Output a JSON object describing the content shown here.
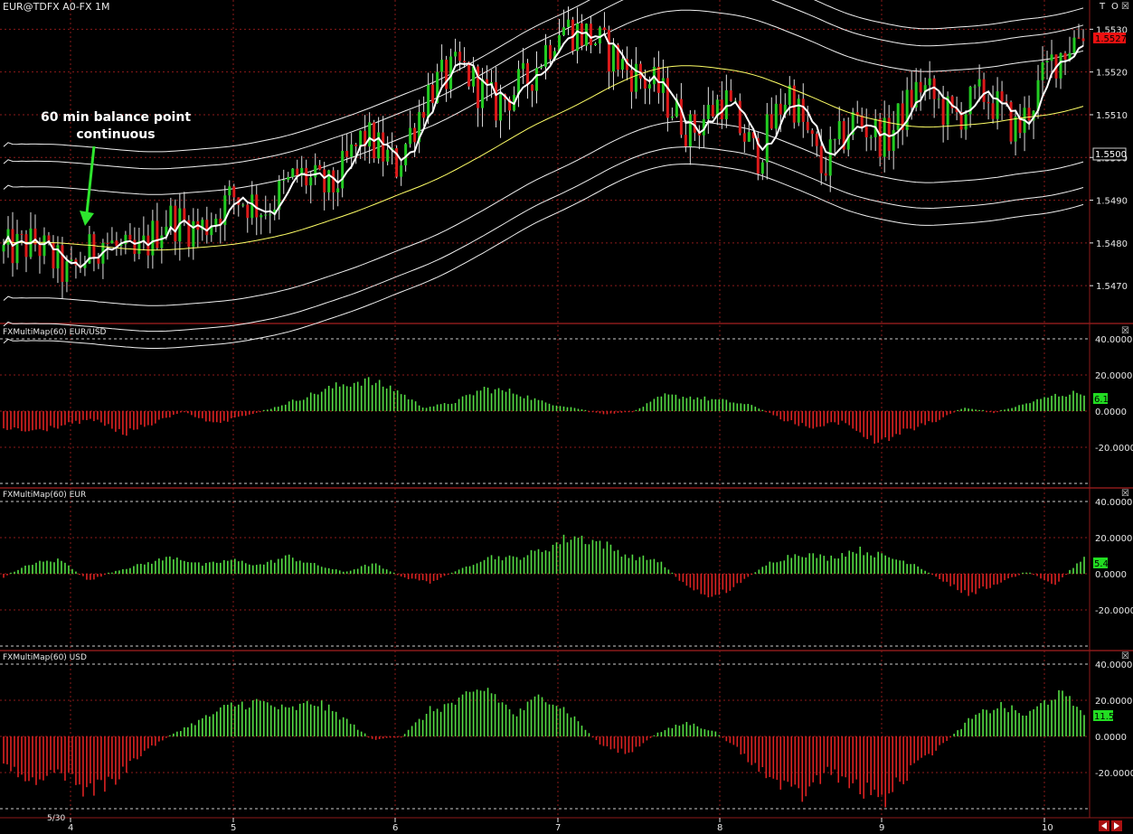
{
  "window": {
    "title": "EUR@TDFX A0-FX 1M",
    "corner_buttons": [
      "T",
      "O",
      "☒"
    ]
  },
  "annotation": {
    "line1": "60 min balance point",
    "line2": "continuous",
    "color": "#2ee62e"
  },
  "colors": {
    "up_candle": "#22cc22",
    "down_candle": "#dd1a1a",
    "hist_positive": "#55dd44",
    "hist_negative": "#dd2222",
    "grid": "#8b1a1a",
    "ma_fast": "#ffffff",
    "ma_mid": "#ffff66",
    "bands": "#f0f0f0",
    "last_price_bg": "#ee1111",
    "value_label_bg": "#22dd22"
  },
  "x_axis": {
    "labels": [
      "4",
      "5",
      "6",
      "7",
      "8",
      "9",
      "10"
    ],
    "date_label": "5/30"
  },
  "chart_data": [
    {
      "type": "line",
      "title": "EUR@TDFX A0-FX 1M",
      "y_ticks": [
        "1.5530",
        "1.5520",
        "1.5510",
        "1.5500",
        "1.5490",
        "1.5480",
        "1.5470"
      ],
      "ylim": [
        1.5462,
        1.5536
      ],
      "last_price": "1.5527",
      "marked_level": "1.5500",
      "x_labels": [
        "4",
        "5",
        "6",
        "7",
        "8",
        "9",
        "10"
      ],
      "price_path": [
        1.5478,
        1.548,
        1.5472,
        1.5481,
        1.5476,
        1.5486,
        1.5483,
        1.5491,
        1.5488,
        1.5496,
        1.5492,
        1.5505,
        1.5498,
        1.5516,
        1.5521,
        1.5512,
        1.5518,
        1.5531,
        1.5528,
        1.5521,
        1.5516,
        1.5506,
        1.5514,
        1.55,
        1.5516,
        1.5497,
        1.5509,
        1.5504,
        1.5517,
        1.5509,
        1.5515,
        1.5506,
        1.5522,
        1.553
      ],
      "grid": true
    },
    {
      "type": "bar",
      "title": "FXMultiMap(60) EUR/USD",
      "y_ticks": [
        "40.0000",
        "20.0000",
        "0.0000",
        "-20.0000"
      ],
      "ylim": [
        -40,
        40
      ],
      "last_value": "6.1",
      "profile": [
        -10,
        -12,
        -8,
        -5,
        -13,
        -7,
        0,
        -8,
        -3,
        2,
        8,
        14,
        18,
        13,
        2,
        5,
        13,
        11,
        5,
        2,
        -2,
        0,
        9,
        8,
        6,
        3,
        -5,
        -10,
        -6,
        -18,
        -12,
        -6,
        2,
        -1,
        4,
        9,
        11
      ]
    },
    {
      "type": "bar",
      "title": "FXMultiMap(60) EUR",
      "y_ticks": [
        "40.0000",
        "20.0000",
        "0.0000",
        "-20.0000"
      ],
      "ylim": [
        -40,
        40
      ],
      "last_value": "5.4",
      "profile": [
        -2,
        6,
        8,
        -4,
        2,
        6,
        10,
        5,
        8,
        5,
        10,
        5,
        1,
        6,
        -2,
        -5,
        2,
        10,
        9,
        14,
        22,
        18,
        10,
        8,
        -7,
        -14,
        -4,
        7,
        12,
        9,
        14,
        10,
        6,
        -4,
        -12,
        -5,
        1,
        -6,
        10
      ]
    },
    {
      "type": "bar",
      "title": "FXMultiMap(60) USD",
      "y_ticks": [
        "40.0000",
        "20.0000",
        "0.0000",
        "-20.0000"
      ],
      "ylim": [
        -40,
        40
      ],
      "last_value": "11.5",
      "profile": [
        -16,
        -28,
        -20,
        -32,
        -24,
        -8,
        2,
        10,
        18,
        20,
        15,
        20,
        10,
        -2,
        0,
        15,
        20,
        28,
        12,
        25,
        12,
        -5,
        -10,
        2,
        8,
        3,
        -10,
        -25,
        -35,
        -20,
        -30,
        -36,
        -18,
        -5,
        10,
        18,
        12,
        25,
        15
      ]
    }
  ]
}
